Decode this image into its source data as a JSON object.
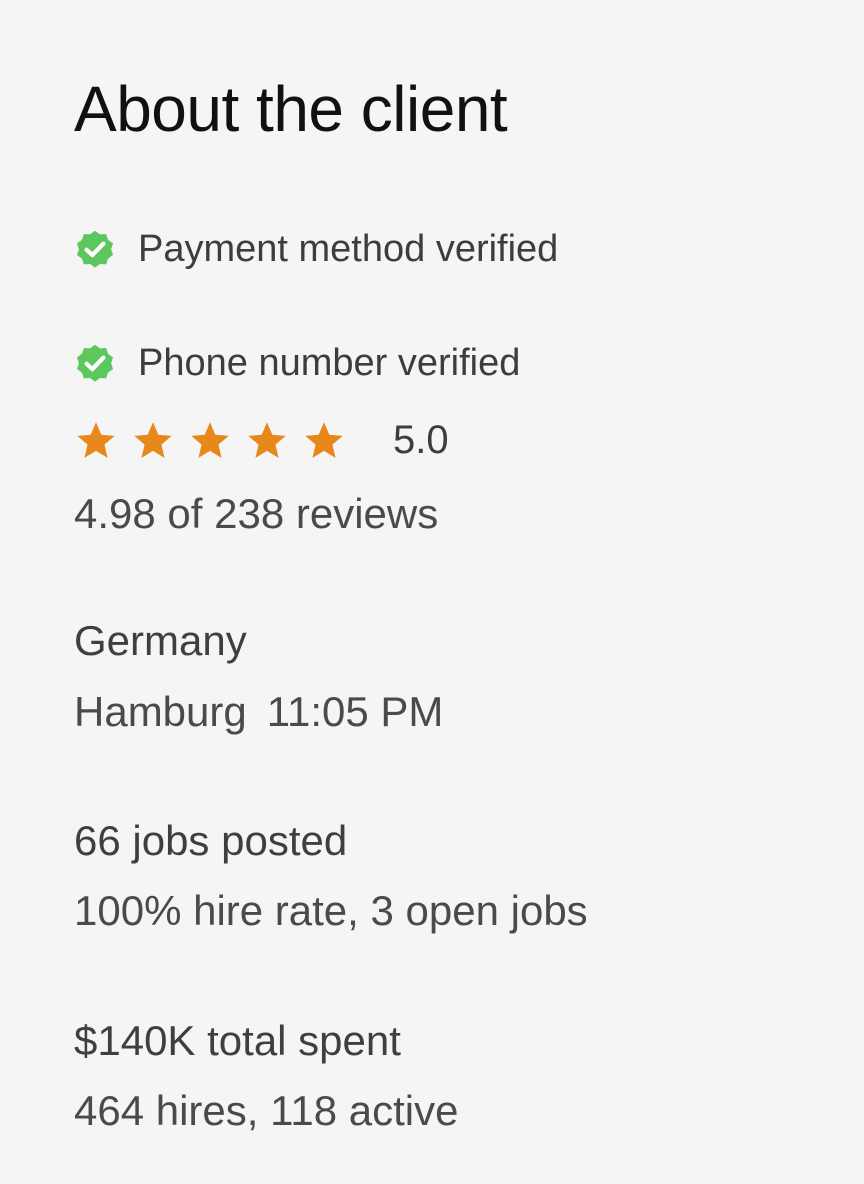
{
  "about_client": {
    "title": "About the client",
    "payment_verified": "Payment method verified",
    "phone_verified": "Phone number verified",
    "rating": {
      "stars": 5,
      "max_stars": 5,
      "value": "5.0",
      "reviews_text": "4.98 of 238 reviews"
    },
    "location": {
      "country": "Germany",
      "city": "Hamburg",
      "local_time": "11:05 PM"
    },
    "jobs": {
      "posted": "66 jobs posted",
      "hire_rate": "100% hire rate, 3 open jobs"
    },
    "spending": {
      "total_spent": "$140K total spent",
      "hires": "464 hires, 118 active"
    },
    "colors": {
      "verified_green": "#5cc75c",
      "star_orange": "#e8871a",
      "background": "#f5f5f5"
    },
    "icons": {
      "verified": "verified-badge-icon",
      "star": "star-icon"
    }
  }
}
